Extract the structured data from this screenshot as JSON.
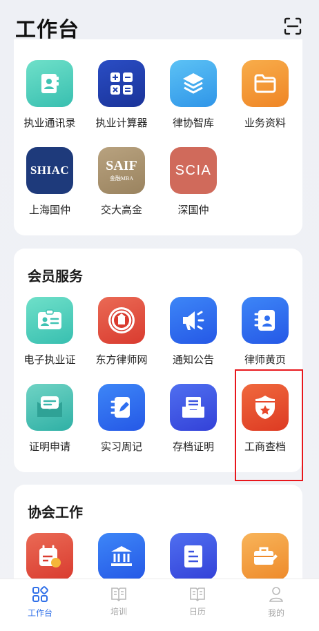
{
  "header": {
    "title": "工作台",
    "scan_icon": "scan-icon"
  },
  "tools": [
    {
      "label": "执业通讯录",
      "icon": "contact-book-icon",
      "color": "#3fc3b3"
    },
    {
      "label": "执业计算器",
      "icon": "calculator-icon",
      "color": "#1f3fae"
    },
    {
      "label": "律协智库",
      "icon": "layers-icon",
      "color": "#35a4ec"
    },
    {
      "label": "业务资料",
      "icon": "folder-icon",
      "color": "#f28f2c"
    },
    {
      "label": "上海国仲",
      "icon": "shiac-logo-icon",
      "logo_text": "SHIAC",
      "color": "#1e3a7b"
    },
    {
      "label": "交大高金",
      "icon": "saif-logo-icon",
      "logo_text": "SAIF",
      "logo_sub": "金融MBA",
      "color": "#a89270"
    },
    {
      "label": "深国仲",
      "icon": "scia-logo-icon",
      "logo_text": "SCIA",
      "color": "#d06a5b"
    }
  ],
  "member_services": {
    "title": "会员服务",
    "items": [
      {
        "label": "电子执业证",
        "icon": "id-card-icon",
        "color": "#3fc3b3"
      },
      {
        "label": "东方律师网",
        "icon": "emblem-icon",
        "color": "#e1483c"
      },
      {
        "label": "通知公告",
        "icon": "megaphone-icon",
        "color": "#2e6ff0"
      },
      {
        "label": "律师黄页",
        "icon": "address-book-icon",
        "color": "#2e6ff0"
      },
      {
        "label": "证明申请",
        "icon": "message-form-icon",
        "color": "#39b6ac"
      },
      {
        "label": "实习周记",
        "icon": "notebook-pen-icon",
        "color": "#2e6ff0"
      },
      {
        "label": "存档证明",
        "icon": "archive-tray-icon",
        "color": "#3a52e0"
      },
      {
        "label": "工商查档",
        "icon": "shield-star-icon",
        "color": "#e8472a"
      }
    ]
  },
  "association_work": {
    "title": "协会工作",
    "items": [
      {
        "icon": "calendar-clock-icon",
        "color": "#e1483c"
      },
      {
        "icon": "institution-icon",
        "color": "#2e6ff0"
      },
      {
        "icon": "document-icon",
        "color": "#3a52e0"
      },
      {
        "icon": "briefcase-edit-icon",
        "color": "#f28f2c"
      }
    ]
  },
  "tabbar": [
    {
      "label": "工作台",
      "icon": "grid-icon",
      "active": true
    },
    {
      "label": "培训",
      "icon": "book-icon",
      "active": false
    },
    {
      "label": "日历",
      "icon": "calendar-book-icon",
      "active": false
    },
    {
      "label": "我的",
      "icon": "user-icon",
      "active": false
    }
  ],
  "colors": {
    "accent": "#2f6fe8",
    "highlight_border": "#e8171c"
  }
}
